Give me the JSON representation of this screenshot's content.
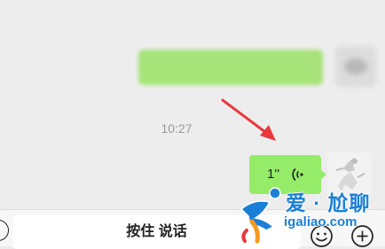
{
  "chat": {
    "blurred_sender_name": "",
    "blurred_message": "",
    "timestamp": "10:27",
    "voice_message": {
      "duration": "1''",
      "icon": "voice-wave-icon",
      "bubble_color": "#95ec69"
    },
    "annotation": {
      "icon": "red-arrow-icon",
      "color": "#e8383d"
    }
  },
  "input_bar": {
    "voice_toggle_icon": "voice-toggle-icon",
    "hold_to_talk_label": "按住 说话",
    "emoji_icon": "emoji-icon",
    "plus_icon": "plus-circle-icon"
  },
  "watermark": {
    "title": "爱 · 尬聊",
    "url": "igaliao.com",
    "logo_icon": "running-figure-logo-icon",
    "color": "#1a7fd6"
  }
}
